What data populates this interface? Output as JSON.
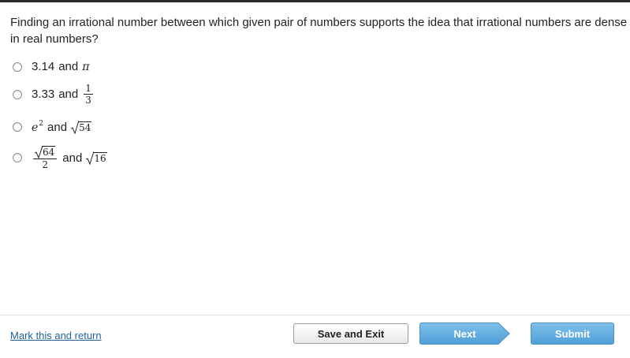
{
  "question": {
    "text": "Finding an irrational number between which given pair of numbers supports the idea that irrational numbers are dense in real numbers?"
  },
  "options": [
    {
      "a": "3.14",
      "joiner": "and",
      "b": "π"
    },
    {
      "a": "3.33",
      "joiner": "and",
      "b_num": "1",
      "b_den": "3"
    },
    {
      "a_base": "e",
      "a_exp": "2",
      "joiner": "and",
      "b_radicand": "54"
    },
    {
      "a_radicand": "64",
      "a_den": "2",
      "joiner": "and",
      "b_radicand": "16"
    }
  ],
  "footer": {
    "mark_link": "Mark this and return",
    "save_exit": "Save and Exit",
    "next": "Next",
    "submit": "Submit"
  },
  "colors": {
    "link": "#1f5f9e",
    "primary_button": "#5aa8de"
  }
}
